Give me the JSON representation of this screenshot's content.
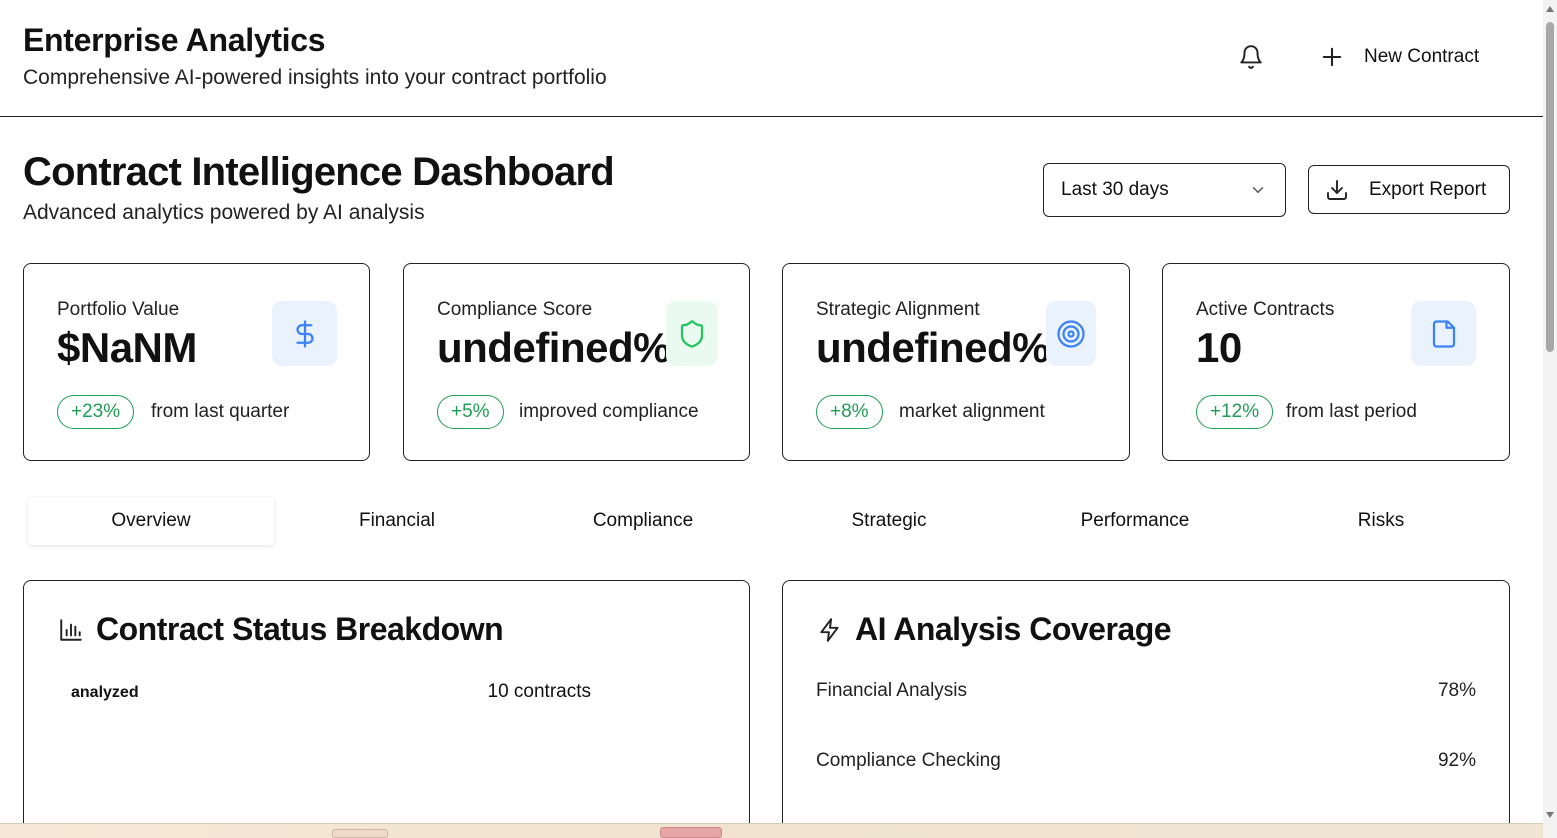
{
  "header": {
    "title": "Enterprise Analytics",
    "subtitle": "Comprehensive AI-powered insights into your contract portfolio",
    "new_contract_label": "New Contract"
  },
  "dashboard": {
    "title": "Contract Intelligence Dashboard",
    "subtitle": "Advanced analytics powered by AI analysis",
    "date_range": "Last 30 days",
    "export_label": "Export Report"
  },
  "stats": [
    {
      "label": "Portfolio Value",
      "value": "$NaNM",
      "change": "+23%",
      "note": "from last quarter",
      "icon": "dollar-icon",
      "icon_color": "#3b82f6",
      "icon_bg": "#eaf2fd"
    },
    {
      "label": "Compliance Score",
      "value": "undefined%",
      "change": "+5%",
      "note": "improved compliance",
      "icon": "shield-icon",
      "icon_color": "#22c55e",
      "icon_bg": "#eafaf1"
    },
    {
      "label": "Strategic Alignment",
      "value": "undefined%",
      "change": "+8%",
      "note": "market alignment",
      "icon": "target-icon",
      "icon_color": "#3b82f6",
      "icon_bg": "#eaf2fd"
    },
    {
      "label": "Active Contracts",
      "value": "10",
      "change": "+12%",
      "note": "from last period",
      "icon": "document-icon",
      "icon_color": "#3b82f6",
      "icon_bg": "#eaf2fd"
    }
  ],
  "tabs": [
    {
      "label": "Overview",
      "active": true
    },
    {
      "label": "Financial",
      "active": false
    },
    {
      "label": "Compliance",
      "active": false
    },
    {
      "label": "Strategic",
      "active": false
    },
    {
      "label": "Performance",
      "active": false
    },
    {
      "label": "Risks",
      "active": false
    }
  ],
  "status_breakdown": {
    "title": "Contract Status Breakdown",
    "rows": [
      {
        "status": "analyzed",
        "count": "10 contracts"
      }
    ]
  },
  "ai_coverage": {
    "title": "AI Analysis Coverage",
    "rows": [
      {
        "label": "Financial Analysis",
        "value": "78%"
      },
      {
        "label": "Compliance Checking",
        "value": "92%"
      }
    ]
  },
  "colors": {
    "positive": "#1f9d55",
    "accent_blue": "#3b82f6",
    "accent_green": "#22c55e"
  }
}
